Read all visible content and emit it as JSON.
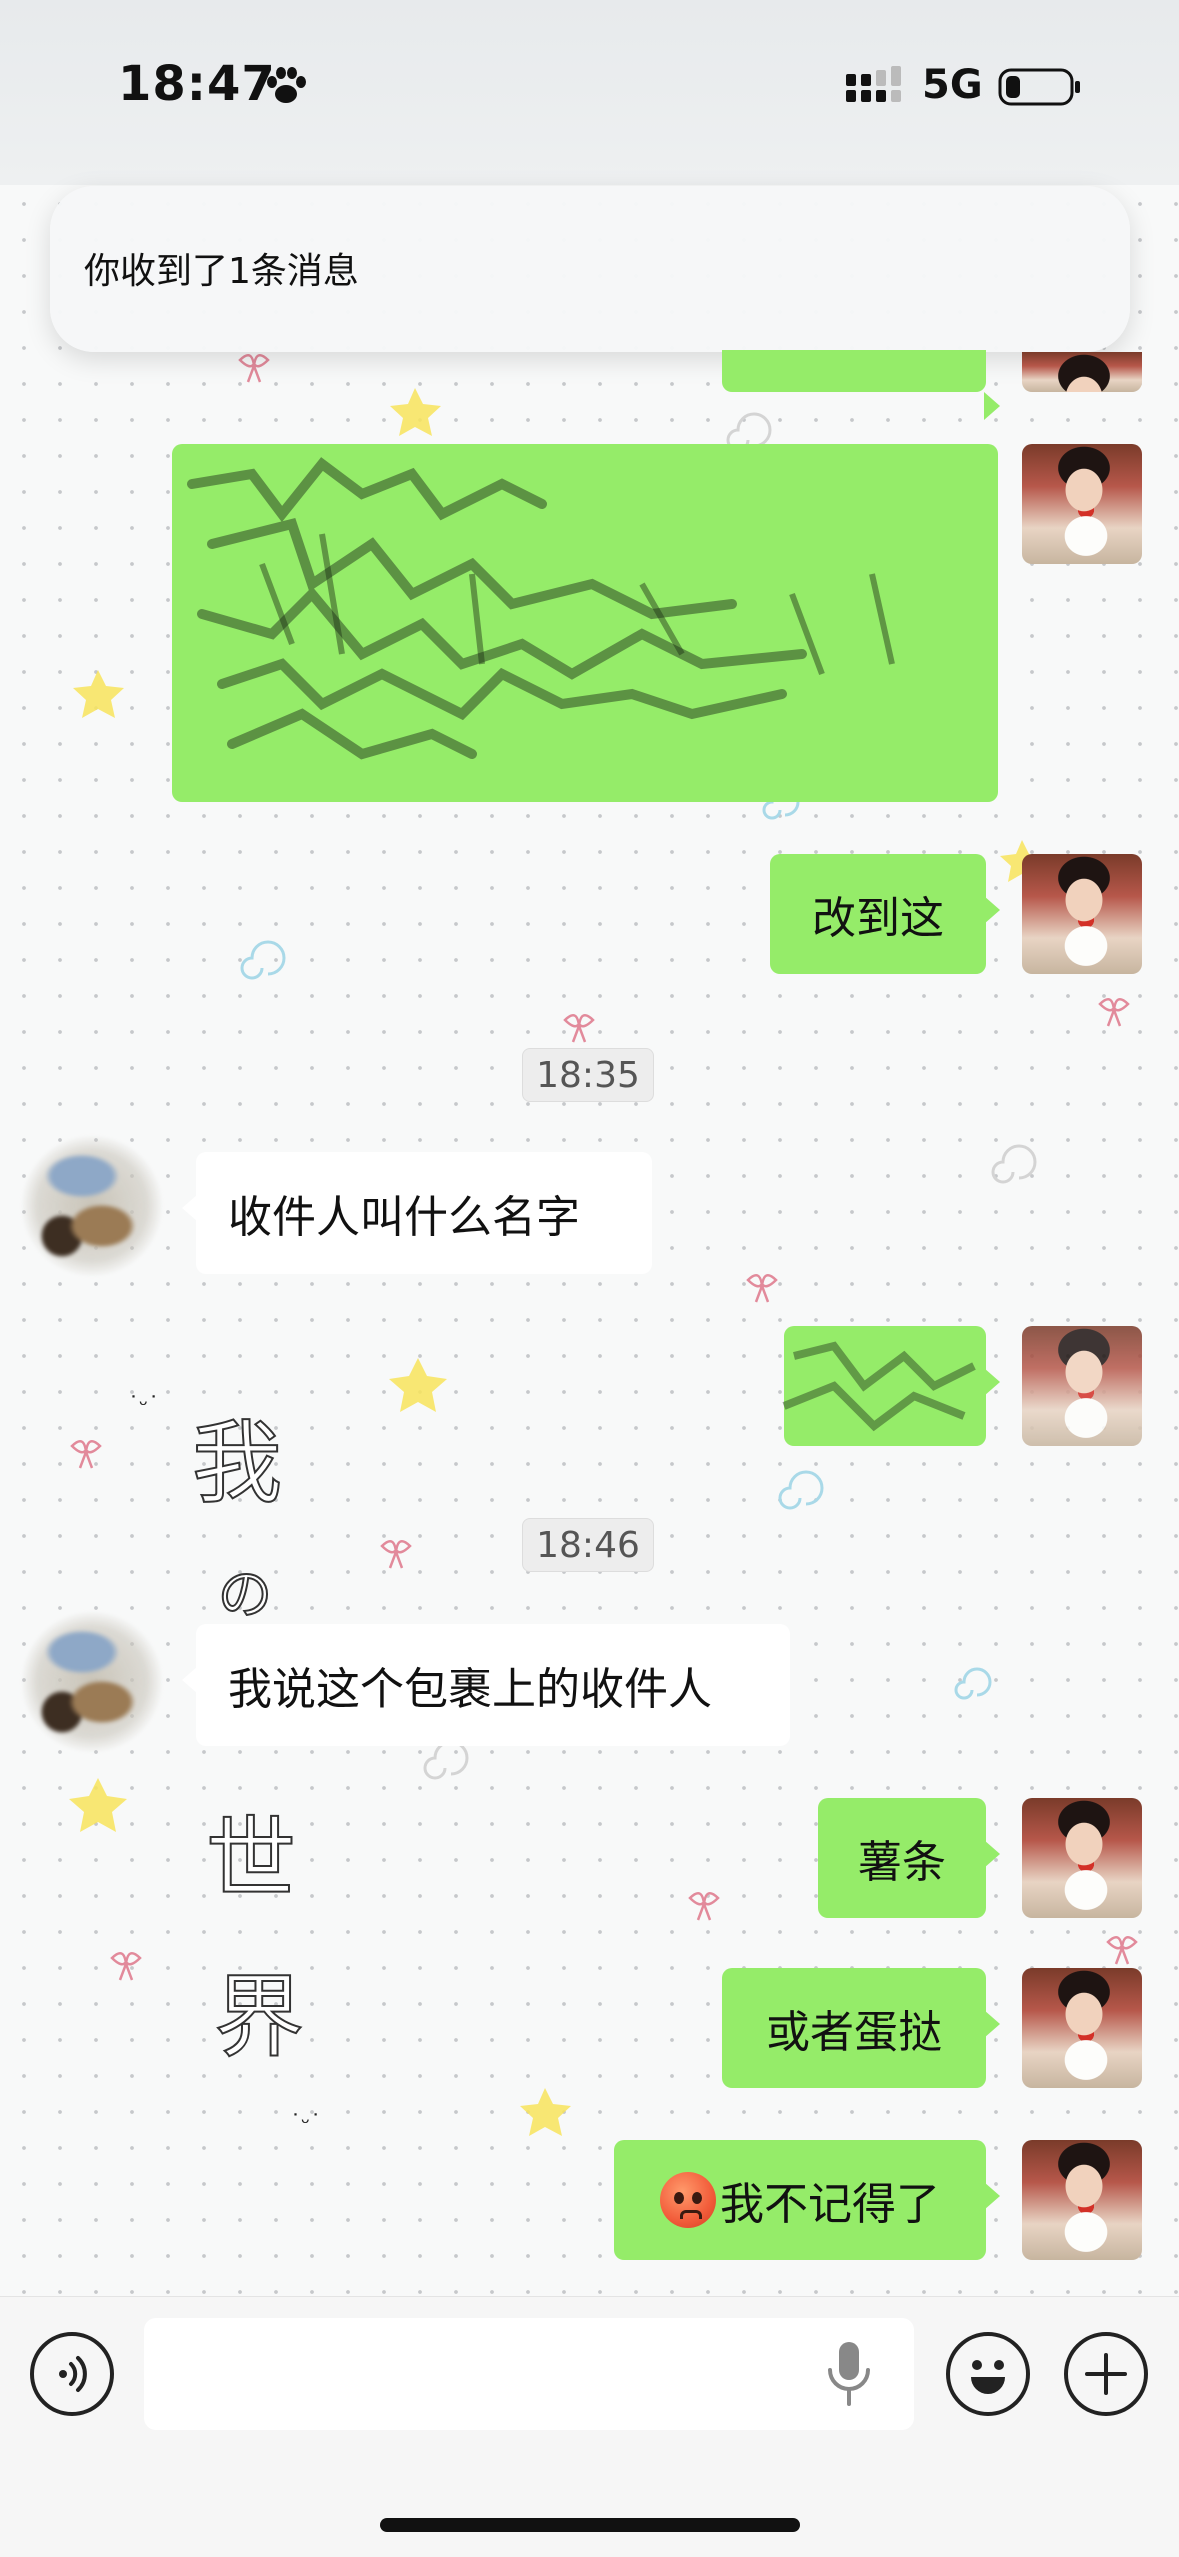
{
  "status_bar": {
    "time": "18:47",
    "network": "5G",
    "icons": [
      "paw-icon",
      "cellular-signal-icon",
      "battery-icon"
    ]
  },
  "notification": {
    "text": "你收到了1条消息"
  },
  "chat": {
    "timestamps": [
      "18:35",
      "18:46"
    ],
    "messages": [
      {
        "side": "me",
        "text": "改到这"
      },
      {
        "side": "other",
        "text": "收件人叫什么名字"
      },
      {
        "side": "other",
        "text": "我说这个包裹上的收件人"
      },
      {
        "side": "me",
        "text": "薯条"
      },
      {
        "side": "me",
        "text": "或者蛋挞"
      },
      {
        "side": "me",
        "text": "我不记得了",
        "emoji": "flushed-face-emoji"
      }
    ],
    "redacted": [
      "redacted-message",
      "redacted-message"
    ],
    "background_sticker_text": [
      "我",
      "の",
      "世",
      "界"
    ]
  },
  "input_bar": {
    "icons": [
      "voice-toggle-icon",
      "microphone-icon",
      "emoji-icon",
      "plus-icon"
    ],
    "placeholder": ""
  }
}
